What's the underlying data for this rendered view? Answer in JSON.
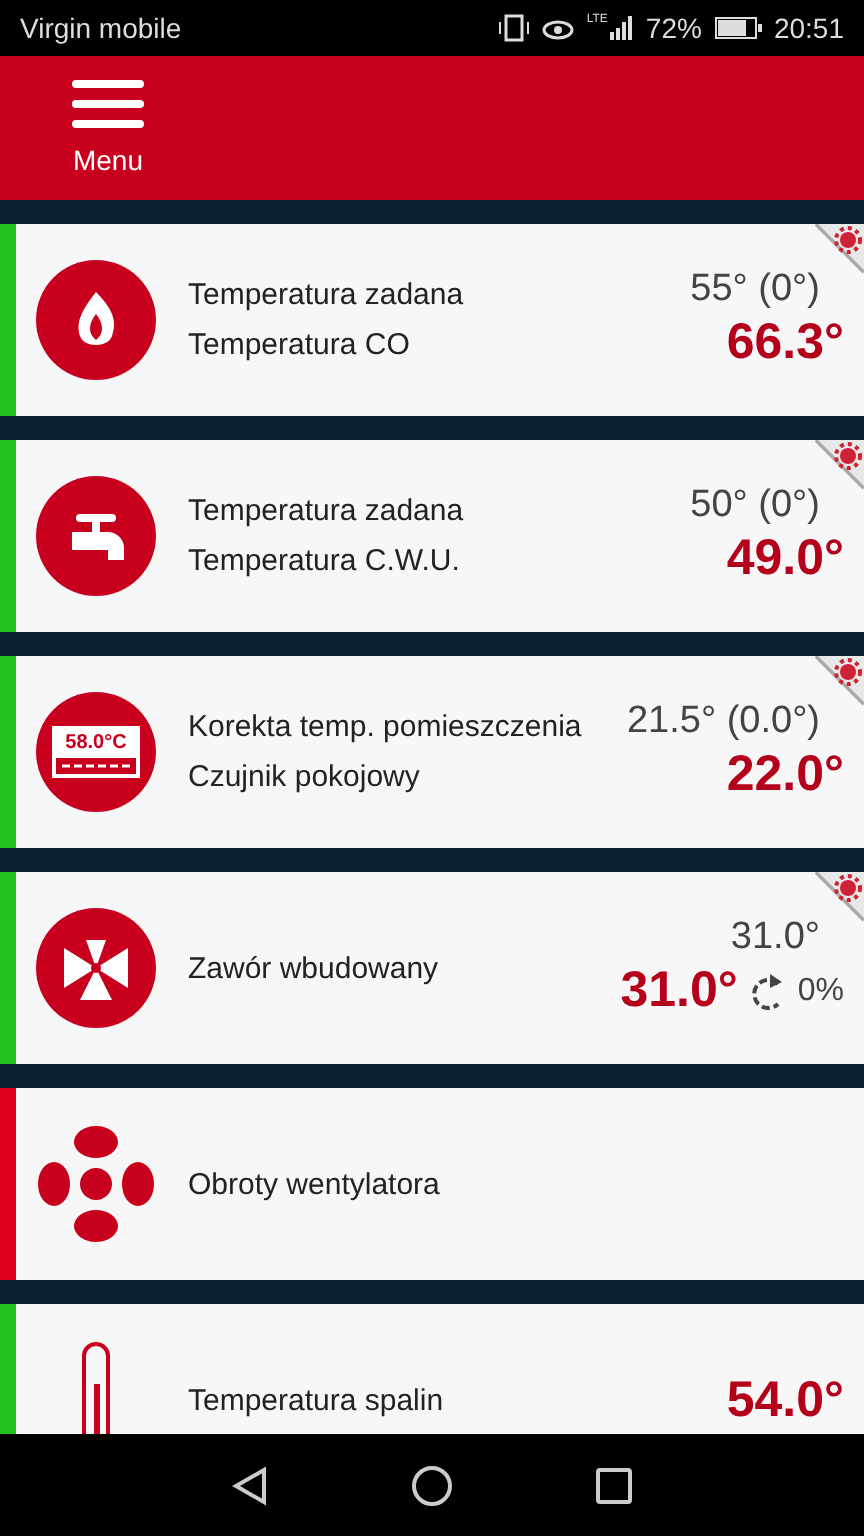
{
  "status_bar": {
    "carrier": "Virgin mobile",
    "network": "LTE",
    "battery": "72%",
    "time": "20:51"
  },
  "header": {
    "menu_label": "Menu"
  },
  "tiles": [
    {
      "kind": "flame",
      "color": "#22c21e",
      "lines": [
        "Temperatura zadana",
        "Temperatura CO"
      ],
      "setpoint": "55° (0°)",
      "value": "66.3°",
      "settings": true
    },
    {
      "kind": "tap",
      "color": "#22c21e",
      "lines": [
        "Temperatura zadana",
        "Temperatura C.W.U."
      ],
      "setpoint": "50° (0°)",
      "value": "49.0°",
      "settings": true
    },
    {
      "kind": "display",
      "icon_text": "58.0°C",
      "color": "#22c21e",
      "lines": [
        "Korekta temp. pomieszczenia",
        "Czujnik pokojowy"
      ],
      "setpoint": "21.5° (0.0°)",
      "value": "22.0°",
      "settings": true
    },
    {
      "kind": "valve",
      "color": "#22c21e",
      "lines": [
        "Zawór wbudowany"
      ],
      "setpoint": "31.0°",
      "value": "31.0°",
      "opening": "0%",
      "settings": true
    },
    {
      "kind": "fan",
      "color": "#e0001b",
      "lines": [
        "Obroty wentylatora"
      ],
      "settings": false
    },
    {
      "kind": "thermometer",
      "color": "#22c21e",
      "lines": [
        "Temperatura spalin"
      ],
      "value": "54.0°",
      "settings": false
    }
  ]
}
